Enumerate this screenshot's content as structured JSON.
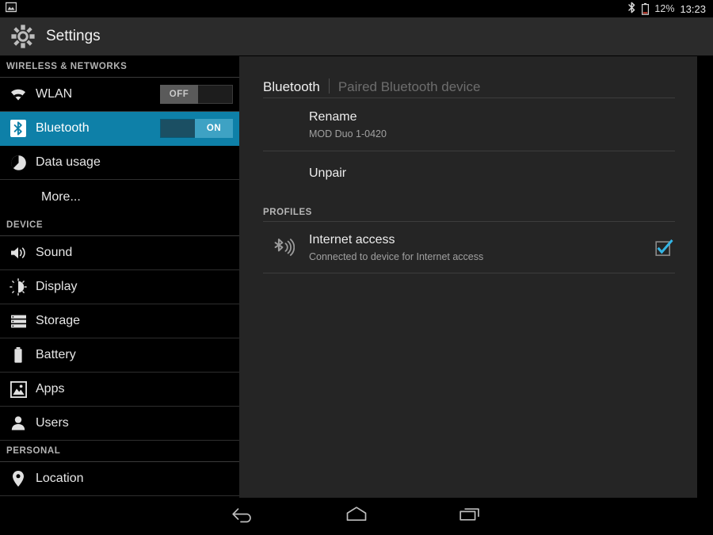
{
  "statusbar": {
    "notification_icon": "screenshot-image-icon",
    "bluetooth_icon": "bluetooth-icon",
    "battery_icon": "battery-low-icon",
    "battery_percent": "12%",
    "clock": "13:23"
  },
  "actionbar": {
    "icon": "settings-gear-icon",
    "title": "Settings"
  },
  "sidebar": {
    "sections": [
      {
        "header": "WIRELESS & NETWORKS",
        "items": [
          {
            "label": "WLAN",
            "icon": "wifi-icon",
            "toggle": "OFF",
            "toggle_state": "off",
            "selected": false,
            "has_icon": true
          },
          {
            "label": "Bluetooth",
            "icon": "bluetooth-icon",
            "toggle": "ON",
            "toggle_state": "on",
            "selected": true,
            "has_icon": true
          },
          {
            "label": "Data usage",
            "icon": "data-usage-pie-icon",
            "toggle": null,
            "selected": false,
            "has_icon": true
          },
          {
            "label": "More...",
            "icon": null,
            "toggle": null,
            "selected": false,
            "has_icon": false
          }
        ]
      },
      {
        "header": "DEVICE",
        "items": [
          {
            "label": "Sound",
            "icon": "speaker-volume-icon",
            "toggle": null,
            "selected": false,
            "has_icon": true
          },
          {
            "label": "Display",
            "icon": "brightness-icon",
            "toggle": null,
            "selected": false,
            "has_icon": true
          },
          {
            "label": "Storage",
            "icon": "storage-stack-icon",
            "toggle": null,
            "selected": false,
            "has_icon": true
          },
          {
            "label": "Battery",
            "icon": "battery-icon",
            "toggle": null,
            "selected": false,
            "has_icon": true
          },
          {
            "label": "Apps",
            "icon": "apps-image-icon",
            "toggle": null,
            "selected": false,
            "has_icon": true
          },
          {
            "label": "Users",
            "icon": "user-person-icon",
            "toggle": null,
            "selected": false,
            "has_icon": true
          }
        ]
      },
      {
        "header": "PERSONAL",
        "items": [
          {
            "label": "Location",
            "icon": "location-pin-icon",
            "toggle": null,
            "selected": false,
            "has_icon": true
          }
        ]
      }
    ]
  },
  "content": {
    "breadcrumb_current": "Bluetooth",
    "breadcrumb_subtitle": "Paired Bluetooth device",
    "rows": [
      {
        "title": "Rename",
        "subtitle": "MOD Duo 1-0420"
      },
      {
        "title": "Unpair",
        "subtitle": null
      }
    ],
    "profiles_header": "PROFILES",
    "profiles": [
      {
        "icon": "bluetooth-tethering-icon",
        "title": "Internet access",
        "subtitle": "Connected to device for Internet access",
        "checked": true
      }
    ]
  },
  "navbar": {
    "back": "back-icon",
    "home": "home-icon",
    "recents": "recents-icon"
  },
  "colors": {
    "accent_blue": "#0e80a8",
    "checkbox_blue": "#33b5e5",
    "panel_bg": "#252525",
    "sidebar_bg": "#000000",
    "actionbar_bg": "#2b2b2b"
  }
}
